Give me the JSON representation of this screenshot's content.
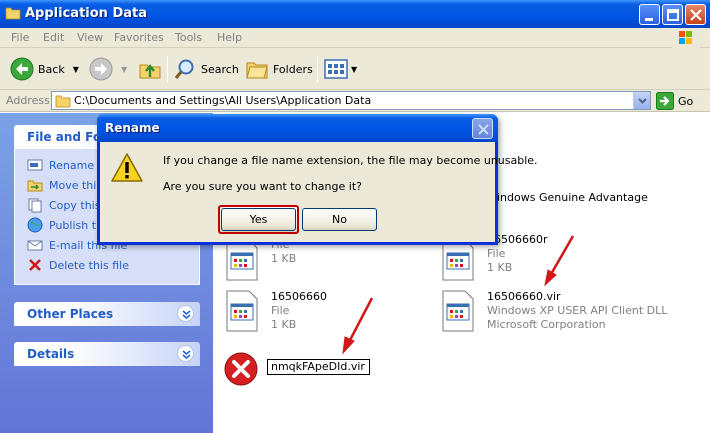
{
  "window": {
    "title": "Application Data"
  },
  "menu": [
    "File",
    "Edit",
    "View",
    "Favorites",
    "Tools",
    "Help"
  ],
  "toolbar": {
    "back": "Back",
    "search": "Search",
    "folders": "Folders"
  },
  "address": {
    "label": "Address",
    "path": "C:\\Documents and Settings\\All Users\\Application Data",
    "go": "Go"
  },
  "taskpane": {
    "file_folder_title": "File and Folde",
    "tasks": [
      "Rename t",
      "Move this",
      "Copy this",
      "Publish th",
      "E-mail this file",
      "Delete this file"
    ],
    "other_places": "Other Places",
    "details": "Details"
  },
  "files": [
    {
      "name": "",
      "line2": "File",
      "line3": "1 KB"
    },
    {
      "name": "16506660r",
      "line2": "File",
      "line3": "1 KB"
    },
    {
      "name": "16506660",
      "line2": "File",
      "line3": "1 KB"
    },
    {
      "name": "16506660.vir",
      "line2": "Windows XP USER API Client DLL",
      "line3": "Microsoft Corporation"
    }
  ],
  "partial_item": "indows Genuine Advantage",
  "rename_value": "nmqkFApeDId.vir",
  "dialog": {
    "title": "Rename",
    "message1": "If you change a file name extension, the file may become unusable.",
    "message2": "Are you sure you want to change it?",
    "yes": "Yes",
    "no": "No"
  },
  "colors": {
    "titlebar": "#0054e3",
    "taskpane": "#6f8ddd",
    "link": "#215dc6",
    "highlight": "#c00000"
  }
}
